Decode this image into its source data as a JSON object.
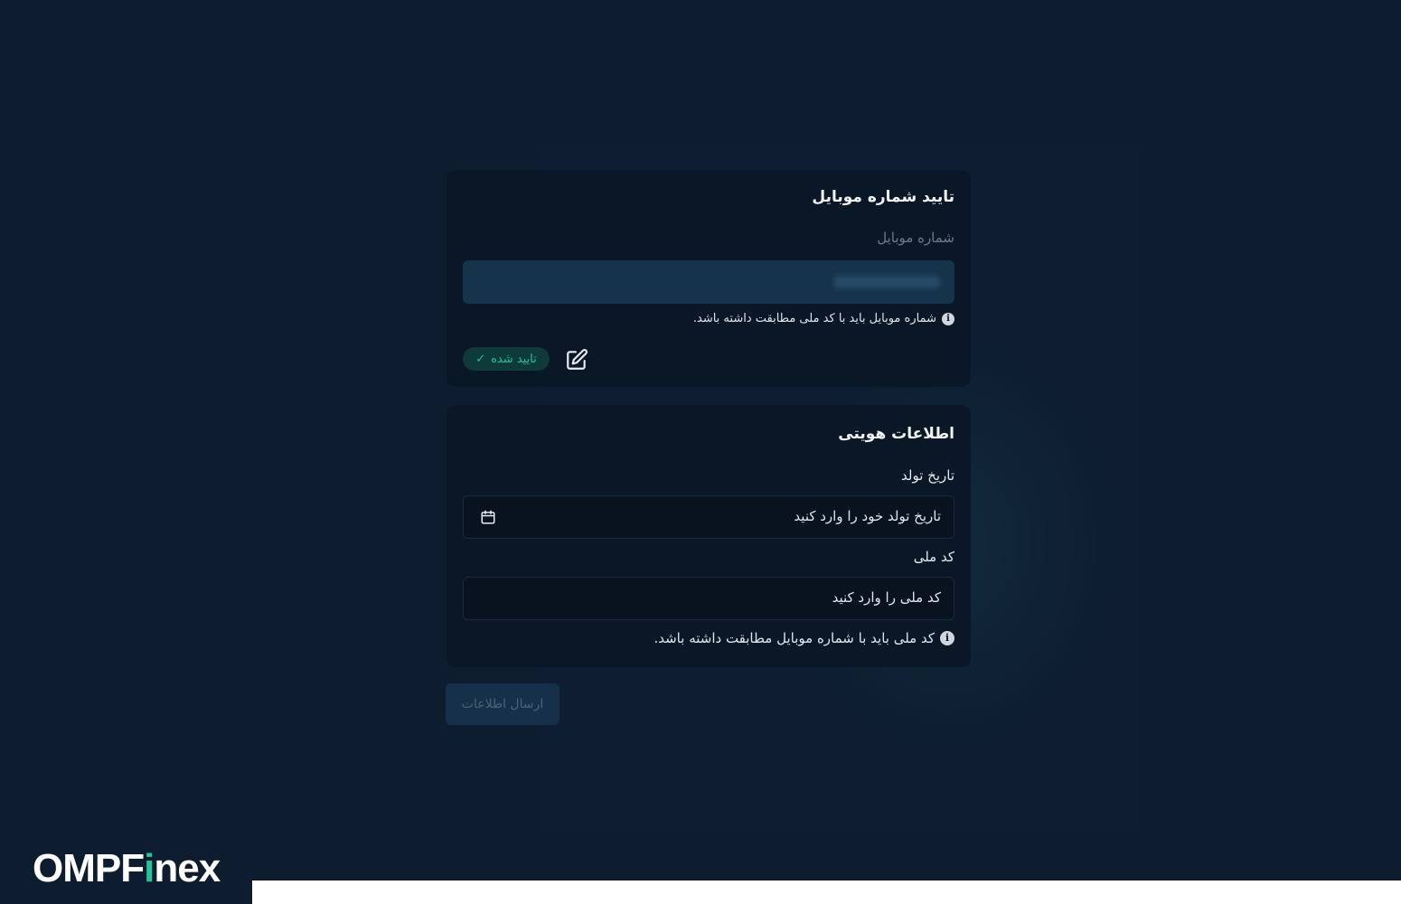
{
  "mobile_section": {
    "title": "تایید شماره موبایل",
    "field_label": "شماره موبایل",
    "hint": "شماره موبایل باید با کد ملی مطابقت داشته باشد.",
    "status_badge": "تایید شده"
  },
  "identity_section": {
    "title": "اطلاعات هویتی",
    "birthdate_label": "تاریخ تولد",
    "birthdate_placeholder": "تاریخ تولد خود را وارد کنید",
    "national_code_label": "کد ملی",
    "national_code_placeholder": "کد ملی را وارد کنید",
    "hint": "کد ملی باید با شماره موبایل مطابقت داشته باشد."
  },
  "submit_label": "ارسال اطلاعات",
  "brand": {
    "prefix": "OMPF",
    "accent_letter": "i",
    "suffix": "nex",
    "accent_color": "#22c59a"
  },
  "colors": {
    "background": "#0e1c30",
    "card": "#0a1726",
    "success": "#1fc3a0"
  },
  "icons": {
    "info": "i",
    "check": "✓"
  }
}
